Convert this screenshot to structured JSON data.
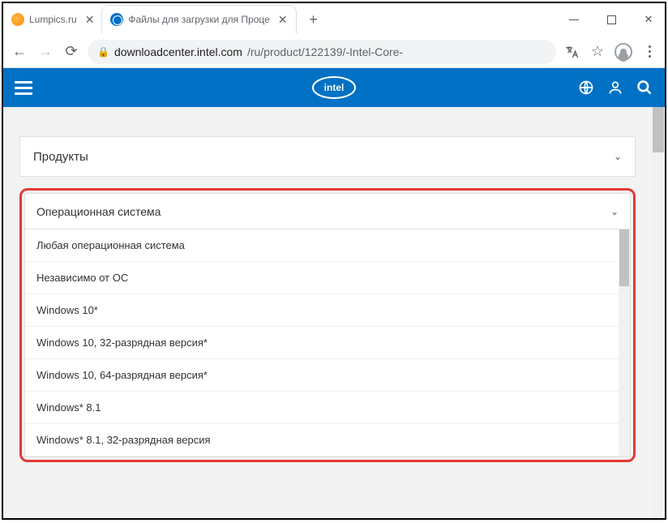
{
  "tabs": [
    {
      "title": "Lumpics.ru",
      "favicon": "orange"
    },
    {
      "title": "Файлы для загрузки для Проце",
      "favicon": "intel"
    }
  ],
  "url": {
    "host": "downloadcenter.intel.com",
    "path": "/ru/product/122139/-Intel-Core-"
  },
  "filters": {
    "products_label": "Продукты",
    "os_label": "Операционная система"
  },
  "os_options": [
    "Любая операционная система",
    "Независимо от ОС",
    "Windows 10*",
    "Windows 10, 32-разрядная версия*",
    "Windows 10, 64-разрядная версия*",
    "Windows* 8.1",
    "Windows* 8.1, 32-разрядная версия"
  ]
}
